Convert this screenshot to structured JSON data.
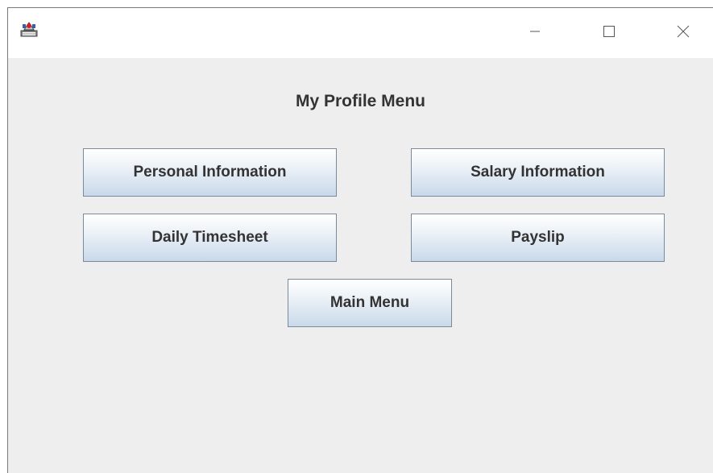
{
  "titlebar": {
    "app_icon": "java-app-icon",
    "minimize_icon": "minimize-icon",
    "maximize_icon": "maximize-icon",
    "close_icon": "close-icon"
  },
  "main": {
    "heading": "My Profile Menu",
    "buttons": {
      "personal_information": "Personal Information",
      "salary_information": "Salary Information",
      "daily_timesheet": "Daily Timesheet",
      "payslip": "Payslip",
      "main_menu": "Main Menu"
    }
  },
  "colors": {
    "window_background": "#eeeeee",
    "titlebar_background": "#ffffff",
    "button_border": "#7a8a99",
    "button_gradient_bottom": "#c9d9ea",
    "text": "#333333"
  }
}
